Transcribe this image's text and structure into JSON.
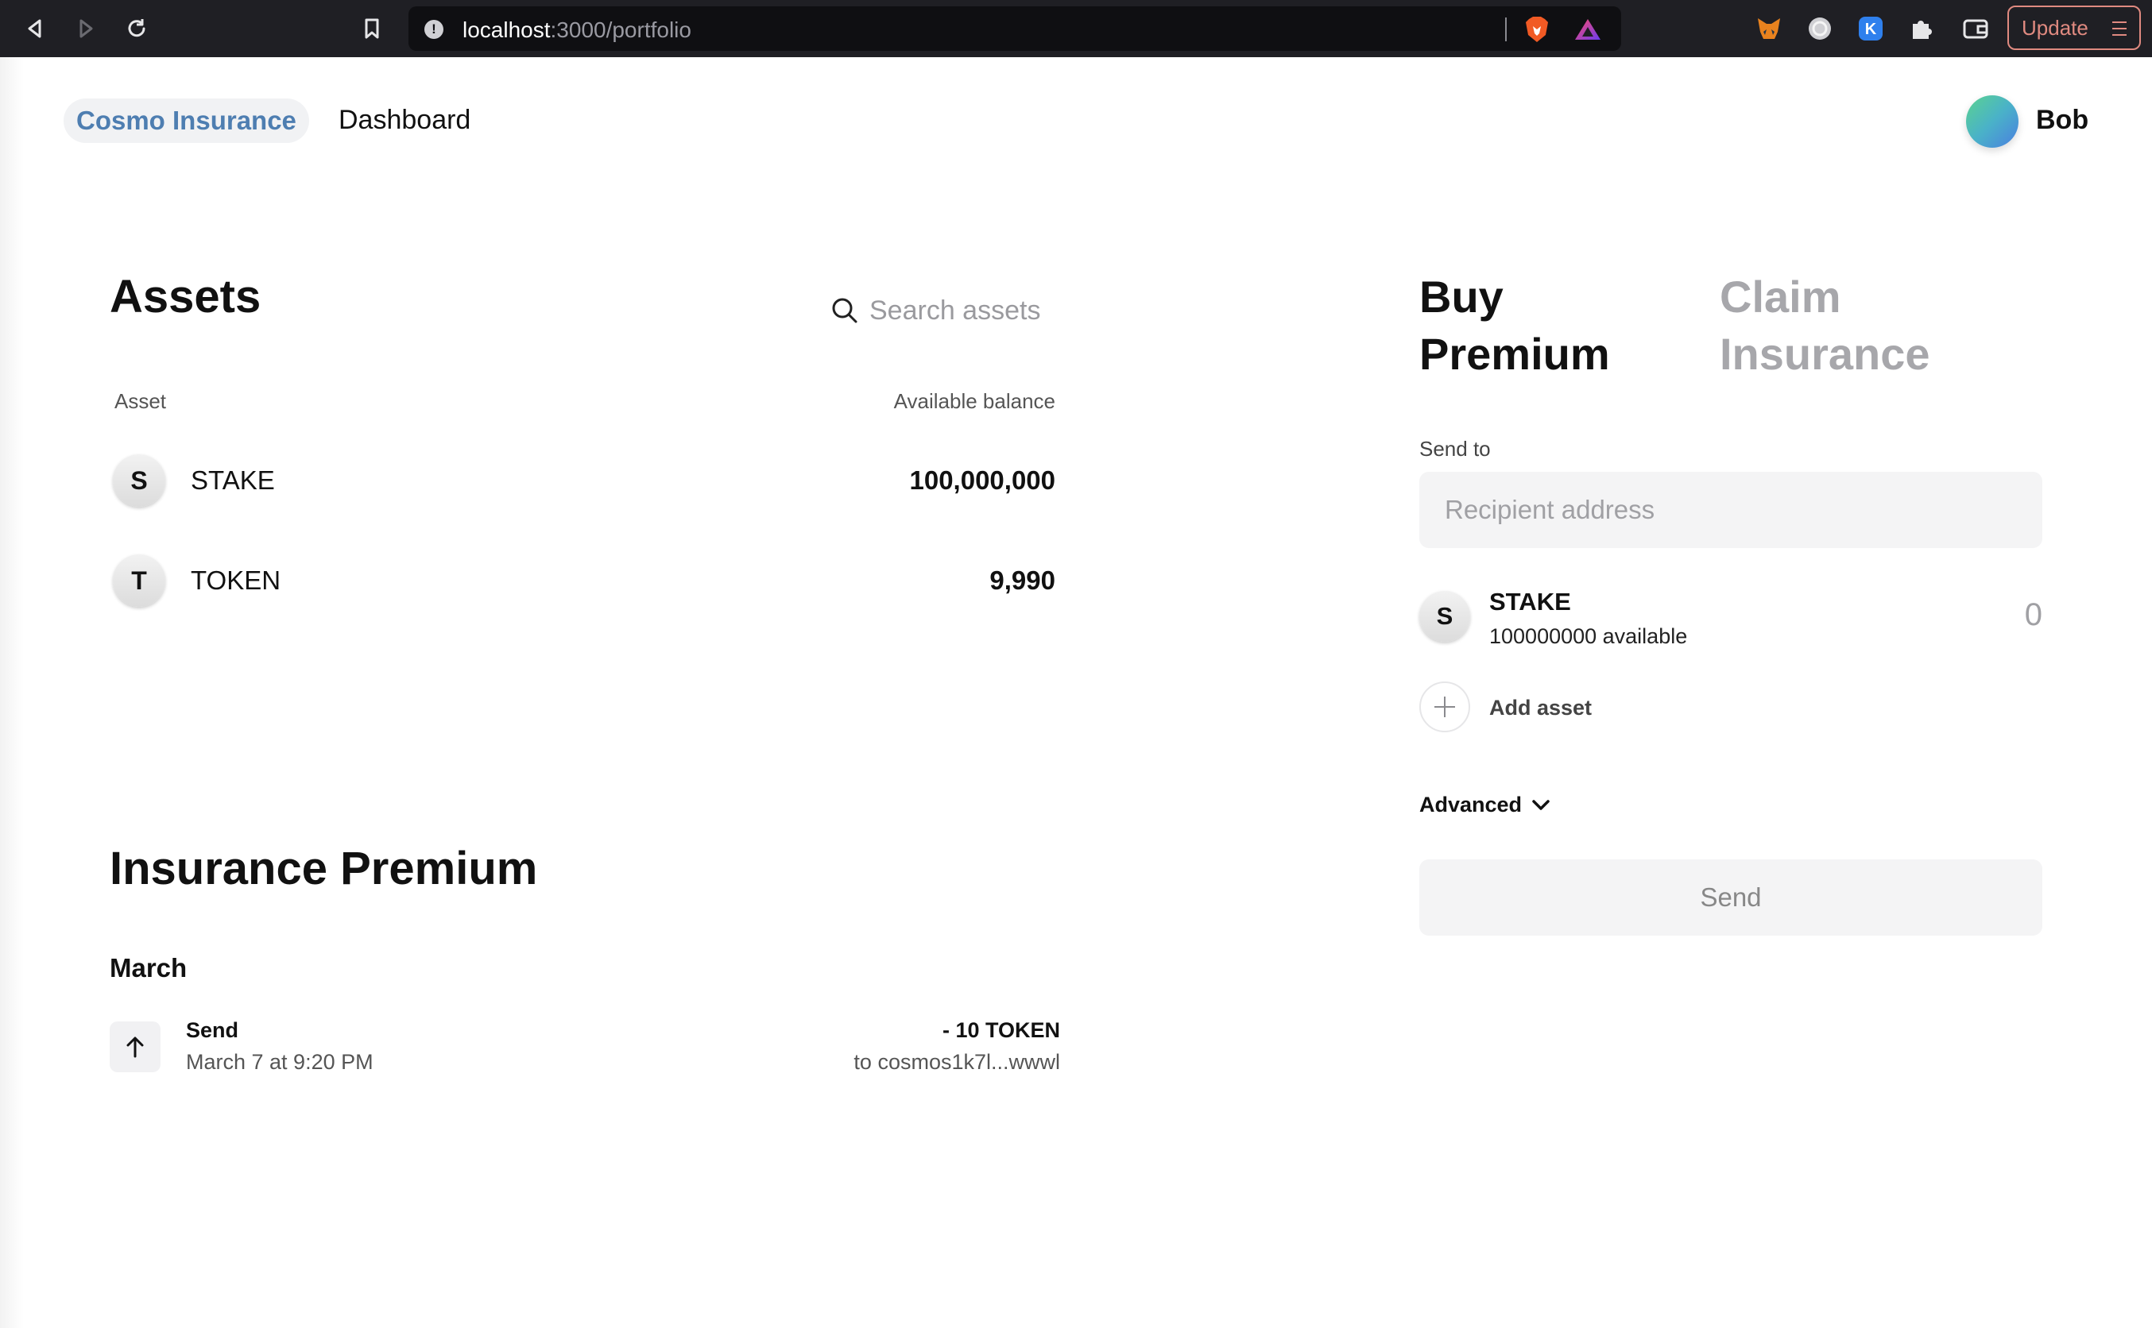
{
  "browser": {
    "url_host": "localhost",
    "url_path": ":3000/portfolio",
    "update_label": "Update"
  },
  "header": {
    "brand": "Cosmo Insurance",
    "nav_dashboard": "Dashboard",
    "user_name": "Bob"
  },
  "assets": {
    "title": "Assets",
    "search_placeholder": "Search assets",
    "col_asset": "Asset",
    "col_balance": "Available balance",
    "rows": [
      {
        "letter": "S",
        "name": "STAKE",
        "balance": "100,000,000"
      },
      {
        "letter": "T",
        "name": "TOKEN",
        "balance": "9,990"
      }
    ]
  },
  "premium": {
    "title": "Insurance Premium",
    "month": "March",
    "tx": {
      "title": "Send",
      "time": "March 7 at 9:20 PM",
      "amount": "- 10 TOKEN",
      "to": "to cosmos1k7l...wwwl"
    }
  },
  "panel": {
    "tab_buy": "Buy Premium",
    "tab_claim": "Claim Insurance",
    "send_to_label": "Send to",
    "recipient_placeholder": "Recipient address",
    "selected_asset": {
      "letter": "S",
      "name": "STAKE",
      "available": "100000000 available",
      "amount": "0"
    },
    "add_asset_label": "Add asset",
    "advanced_label": "Advanced",
    "send_label": "Send"
  },
  "colors": {
    "brand_blue": "#4e7eb1",
    "chrome_bg": "#1f1f24",
    "update_accent": "#e08a80",
    "muted_tab": "#a7a7ab"
  },
  "icons": [
    "back-icon",
    "forward-icon",
    "reload-icon",
    "bookmark-icon",
    "info-icon",
    "brave-shield-icon",
    "brave-rewards-icon",
    "metamask-icon",
    "circle-extension-icon",
    "keplr-icon",
    "puzzle-icon",
    "wallet-icon",
    "search-icon",
    "arrow-up-icon",
    "plus-icon",
    "chevron-down-icon"
  ]
}
